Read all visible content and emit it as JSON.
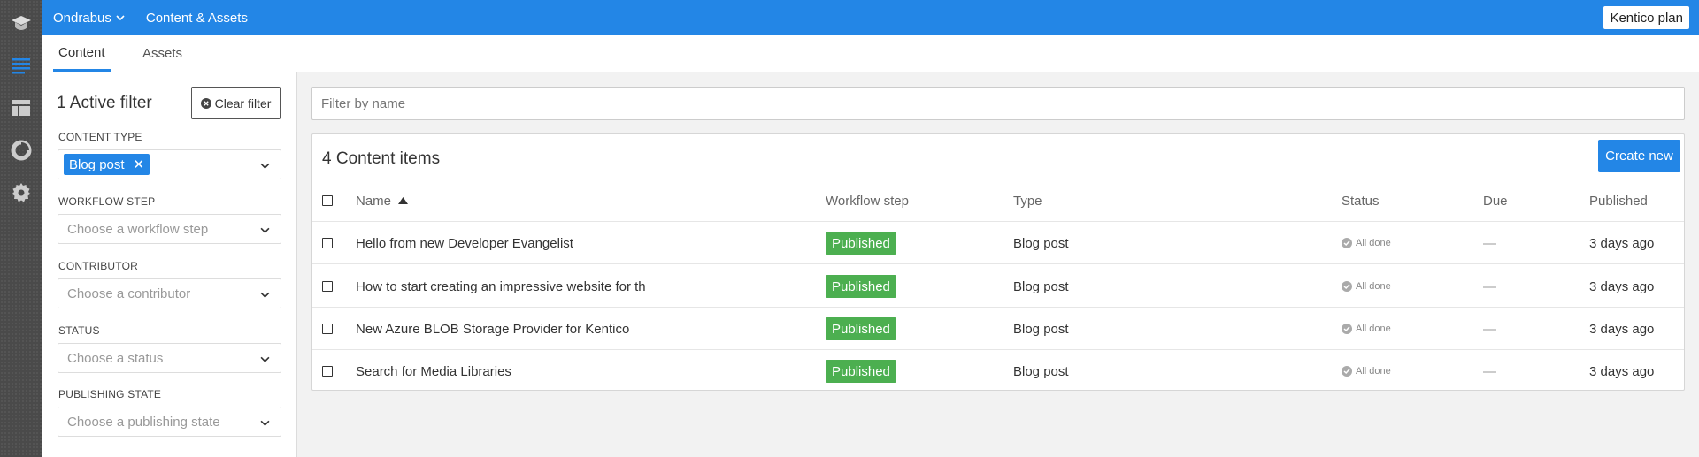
{
  "topbar": {
    "project": "Ondrabus",
    "app": "Content & Assets",
    "plan_button": "Kentico plan"
  },
  "tabs": [
    {
      "label": "Content",
      "active": true
    },
    {
      "label": "Assets",
      "active": false
    }
  ],
  "filters": {
    "title": "1 Active filter",
    "clear_label": "Clear filter",
    "content_type": {
      "label": "CONTENT TYPE",
      "selected": "Blog post"
    },
    "workflow_step": {
      "label": "WORKFLOW STEP",
      "placeholder": "Choose a workflow step"
    },
    "contributor": {
      "label": "CONTRIBUTOR",
      "placeholder": "Choose a contributor"
    },
    "status": {
      "label": "STATUS",
      "placeholder": "Choose a status"
    },
    "publishing_state": {
      "label": "PUBLISHING STATE",
      "placeholder": "Choose a publishing state"
    }
  },
  "search": {
    "placeholder": "Filter by name"
  },
  "list": {
    "title": "4 Content items",
    "create_label": "Create new",
    "columns": {
      "name": "Name",
      "workflow": "Workflow step",
      "type": "Type",
      "status": "Status",
      "due": "Due",
      "published": "Published"
    },
    "rows": [
      {
        "name": "Hello from new Developer Evangelist",
        "workflow": "Published",
        "type": "Blog post",
        "status": "All done",
        "due": "—",
        "published": "3 days ago"
      },
      {
        "name": "How to start creating an impressive website for th",
        "workflow": "Published",
        "type": "Blog post",
        "status": "All done",
        "due": "—",
        "published": "3 days ago"
      },
      {
        "name": "New Azure BLOB Storage Provider for Kentico",
        "workflow": "Published",
        "type": "Blog post",
        "status": "All done",
        "due": "—",
        "published": "3 days ago"
      },
      {
        "name": "Search for Media Libraries",
        "workflow": "Published",
        "type": "Blog post",
        "status": "All done",
        "due": "—",
        "published": "3 days ago"
      }
    ]
  },
  "colors": {
    "accent": "#2386e6",
    "published_badge": "#4caf50",
    "rail": "#4a4a4a"
  },
  "icons": {
    "rail": [
      "graduation-cap-icon",
      "content-list-icon",
      "layout-icon",
      "analytics-icon",
      "gear-icon"
    ]
  }
}
